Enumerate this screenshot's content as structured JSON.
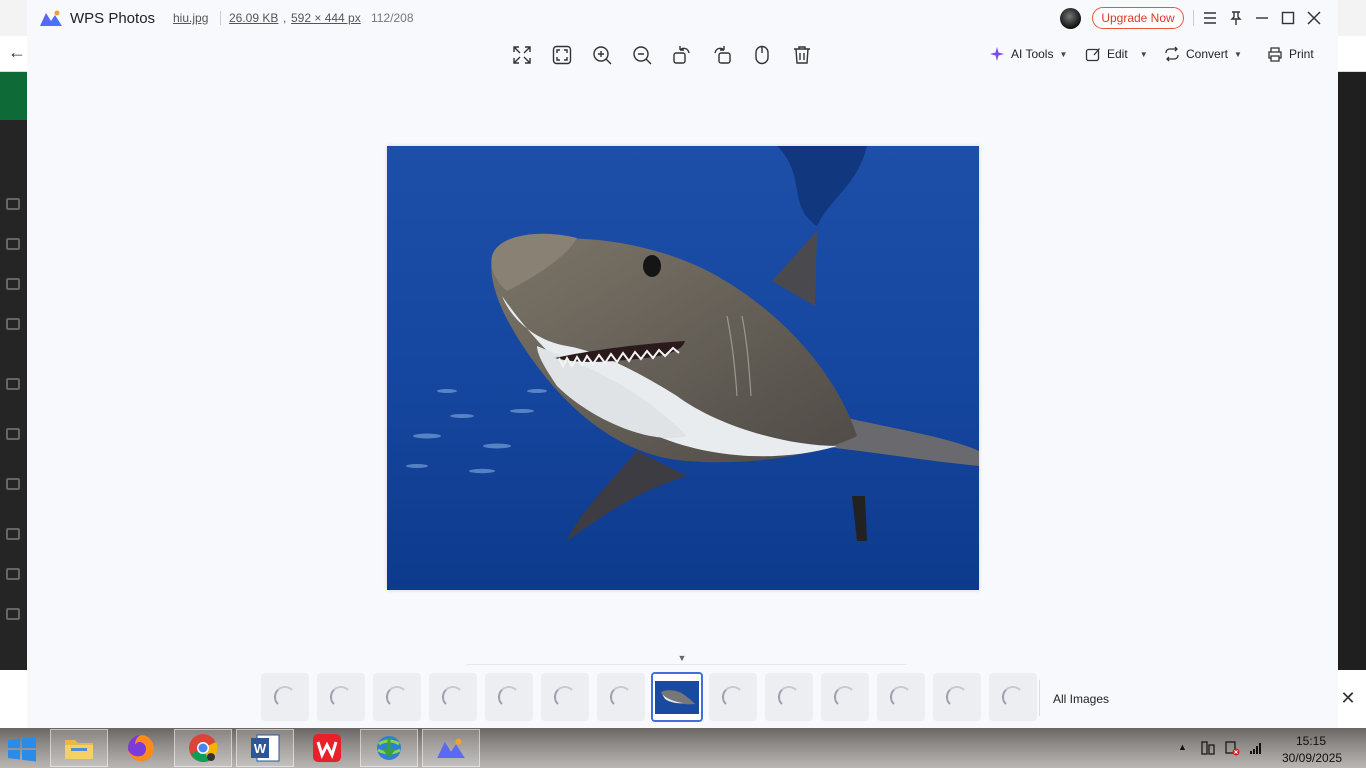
{
  "window": {
    "app_name": "WPS Photos",
    "file_name": "hiu.jpg",
    "file_size": "26.09 KB",
    "comma": ",",
    "dimensions": "592 × 444 px",
    "index": "112/208",
    "upgrade_label": "Upgrade Now"
  },
  "toolbar": {
    "ai_tools_label": "AI Tools",
    "edit_label": "Edit",
    "convert_label": "Convert",
    "print_label": "Print",
    "icons": [
      "fullscreen-icon",
      "fit-to-window-icon",
      "zoom-in-icon",
      "zoom-out-icon",
      "rotate-left-icon",
      "rotate-right-icon",
      "mouse-icon",
      "delete-icon"
    ]
  },
  "filmstrip": {
    "all_images_label": "All Images",
    "active_index": 7,
    "thumbnail_count": 14
  },
  "taskbar": {
    "time": "15:15",
    "date": "30/09/2025",
    "apps": [
      "file-explorer",
      "firefox",
      "chrome",
      "word",
      "wps-office",
      "internet-download-manager",
      "wps-photos"
    ]
  },
  "colors": {
    "accent": "#3e6ee0",
    "upgrade": "#d93a2a",
    "window_bg": "#f7f9fd"
  }
}
